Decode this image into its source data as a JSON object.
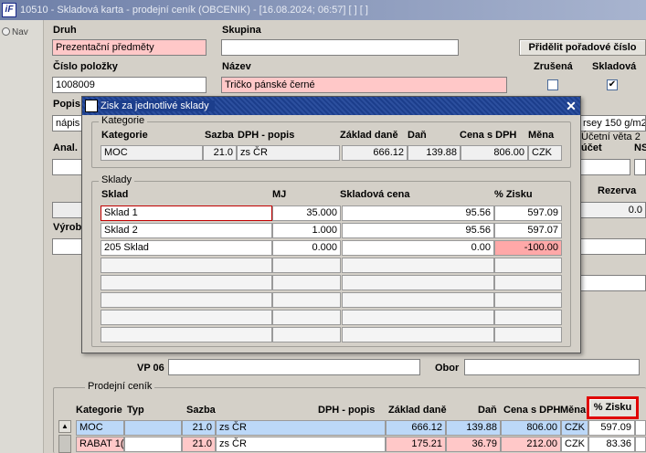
{
  "window": {
    "title": "10510 - Skladová karta - prodejní ceník (OBCENIK) - [16.08.2024; 06:57]  [ ]  [ ]",
    "icon": "app-icon"
  },
  "nav": {
    "label": "Nav"
  },
  "form": {
    "druh_label": "Druh",
    "druh_value": "Prezentační předměty",
    "skupina_label": "Skupina",
    "skupina_value": "",
    "assign_btn": "Přidělit pořadové číslo",
    "cislo_label": "Číslo položky",
    "cislo_value": "1008009",
    "nazev_label": "Název",
    "nazev_value": "Tričko pánské černé",
    "zrusena_label": "Zrušená",
    "skladova_label": "Skladová",
    "zrusena_checked": false,
    "skladova_checked": true,
    "popis_label": "Popis",
    "popis_value": "nápis",
    "right_field_value": "rsey 150 g/m2",
    "anal_label": "Anal.",
    "ucetni_label": "Účetní věta 2",
    "ucet_label": "účet",
    "ns_label": "NS",
    "rezerva_label": "Rezerva",
    "rezerva_value": "0.0",
    "vyrob_label": "Výrob",
    "vp06_label": "VP 06",
    "vp06_value": "",
    "obor_label": "Obor",
    "obor_value": ""
  },
  "dialog": {
    "title": "Zisk za jednotlivé sklady",
    "close": "✕",
    "kategorie_group": {
      "title": "Kategorie",
      "headers": [
        "Kategorie",
        "Sazba",
        "DPH - popis",
        "Základ daně",
        "Daň",
        "Cena s DPH",
        "Měna"
      ],
      "row": [
        "MOC",
        "21.0",
        "zs ČR",
        "666.12",
        "139.88",
        "806.00",
        "CZK"
      ]
    },
    "sklady_group": {
      "title": "Sklady",
      "headers": [
        "Sklad",
        "MJ",
        "Skladová cena",
        "% Zisku"
      ],
      "rows": [
        [
          "Sklad 1",
          "35.000",
          "95.56",
          "597.09"
        ],
        [
          "Sklad 2",
          "1.000",
          "95.56",
          "597.07"
        ],
        [
          "205 Sklad",
          "0.000",
          "0.00",
          "-100.00"
        ]
      ]
    }
  },
  "cenik": {
    "title": "Prodejní ceník",
    "headers": [
      "Kategorie",
      "Typ",
      "Sazba",
      "DPH - popis",
      "Základ daně",
      "Daň",
      "Cena s DPH",
      "Měna"
    ],
    "zisk_btn": "% Zisku",
    "rows": [
      [
        "MOC",
        "",
        "21.0",
        "zs ČR",
        "666.12",
        "139.88",
        "806.00",
        "CZK",
        "597.09"
      ],
      [
        "RABAT 1(",
        "",
        "21.0",
        "zs ČR",
        "175.21",
        "36.79",
        "212.00",
        "CZK",
        "83.36"
      ]
    ]
  },
  "colors": {
    "title_bar": "#6e7fa8",
    "dialog_title": "#1c3e8c",
    "required": "#ffc8c8",
    "highlight": "#e00000"
  }
}
